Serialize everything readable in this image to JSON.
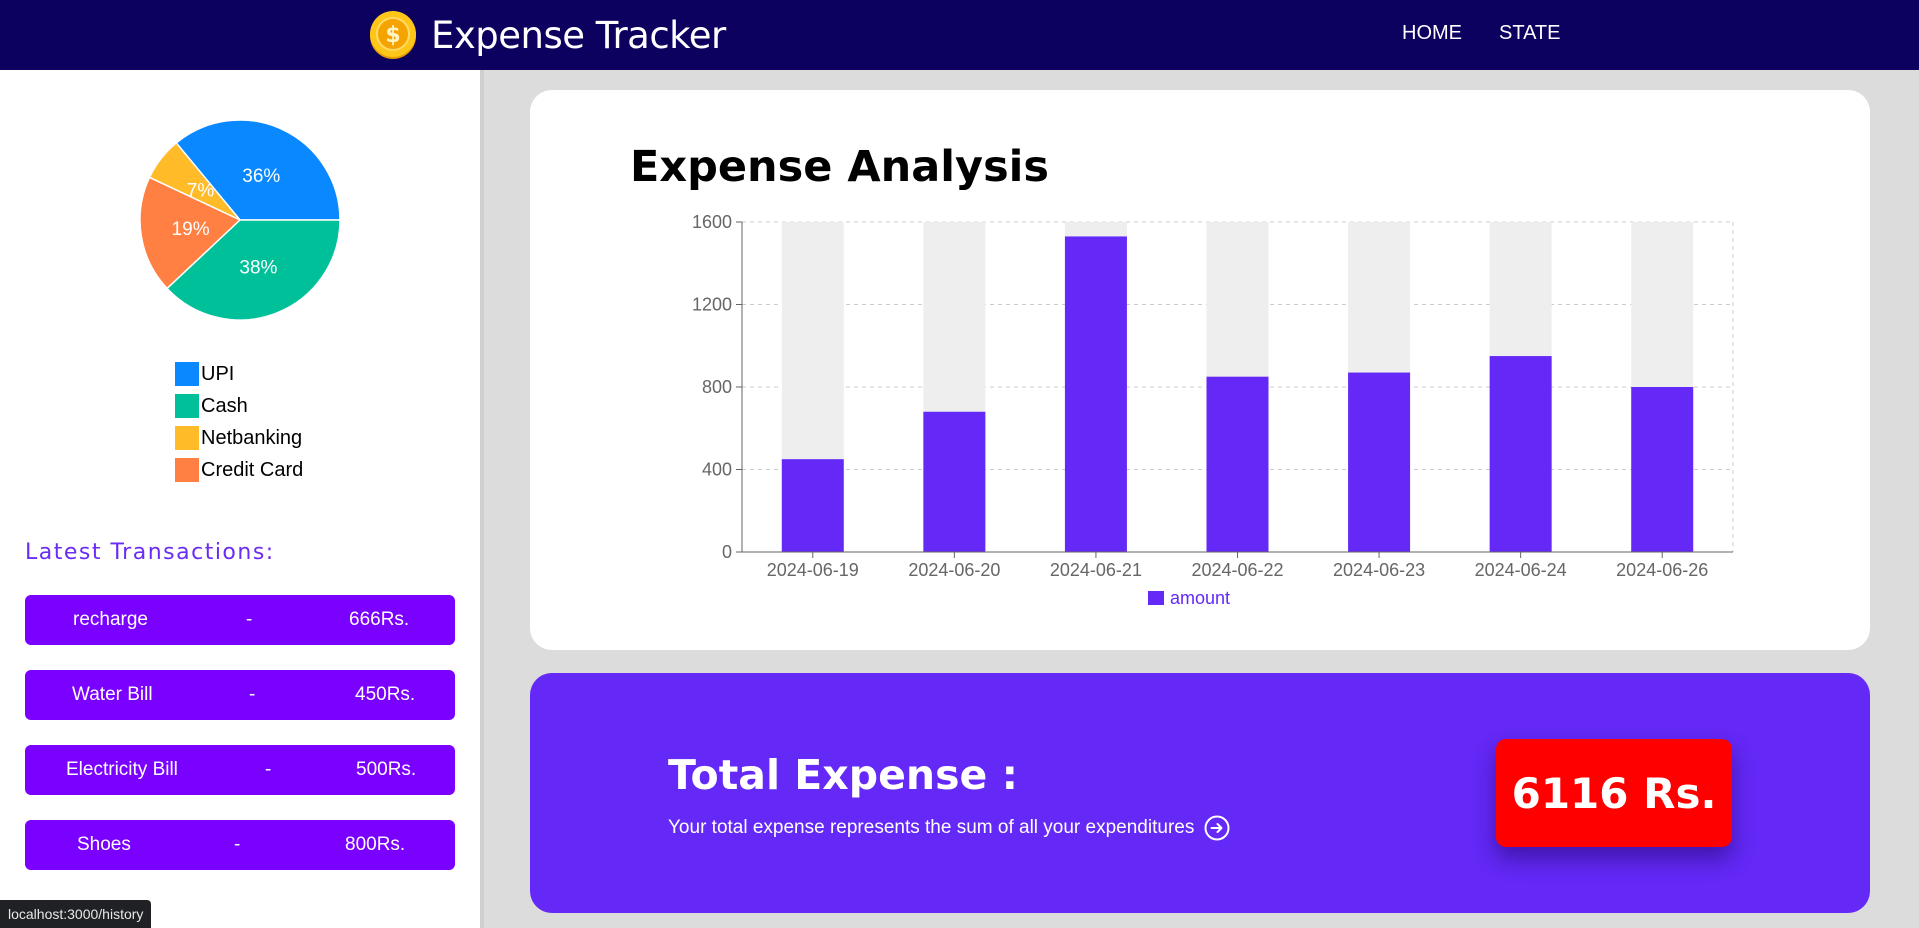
{
  "navbar": {
    "title": "Expense Tracker",
    "links": [
      {
        "label": "HOME"
      },
      {
        "label": "STATE"
      }
    ]
  },
  "payment_pie": {
    "chart_data": {
      "type": "pie",
      "slices": [
        {
          "name": "UPI",
          "percent": 36,
          "label": "36%",
          "color": "#0a88ff"
        },
        {
          "name": "Cash",
          "percent": 38,
          "label": "38%",
          "color": "#00c09a"
        },
        {
          "name": "Netbanking",
          "percent": 7,
          "label": "7%",
          "color": "#ffbb28"
        },
        {
          "name": "Credit Card",
          "percent": 19,
          "label": "19%",
          "color": "#ff8042"
        }
      ]
    }
  },
  "transactions": {
    "heading": "Latest Transactions:",
    "items": [
      {
        "name": "recharge",
        "sep": "-",
        "amount": "666Rs."
      },
      {
        "name": "Water Bill",
        "sep": "-",
        "amount": "450Rs."
      },
      {
        "name": "Electricity Bill",
        "sep": "-",
        "amount": "500Rs."
      },
      {
        "name": "Shoes",
        "sep": "-",
        "amount": "800Rs."
      }
    ]
  },
  "analysis": {
    "title": "Expense Analysis",
    "chart_data": {
      "type": "bar",
      "categories": [
        "2024-06-19",
        "2024-06-20",
        "2024-06-21",
        "2024-06-22",
        "2024-06-23",
        "2024-06-24",
        "2024-06-26"
      ],
      "series": [
        {
          "name": "amount",
          "values": [
            450,
            680,
            1530,
            850,
            870,
            950,
            800
          ],
          "color": "#6428f7"
        }
      ],
      "ylim": [
        0,
        1600
      ],
      "yticks": [
        0,
        400,
        800,
        1200,
        1600
      ],
      "grid": true,
      "legend": "bottom"
    }
  },
  "total": {
    "title": "Total Expense :",
    "description": "Your total expense represents the sum of all your expenditures",
    "amount": "6116 Rs."
  },
  "status_bar": {
    "url": "localhost:3000/history"
  }
}
